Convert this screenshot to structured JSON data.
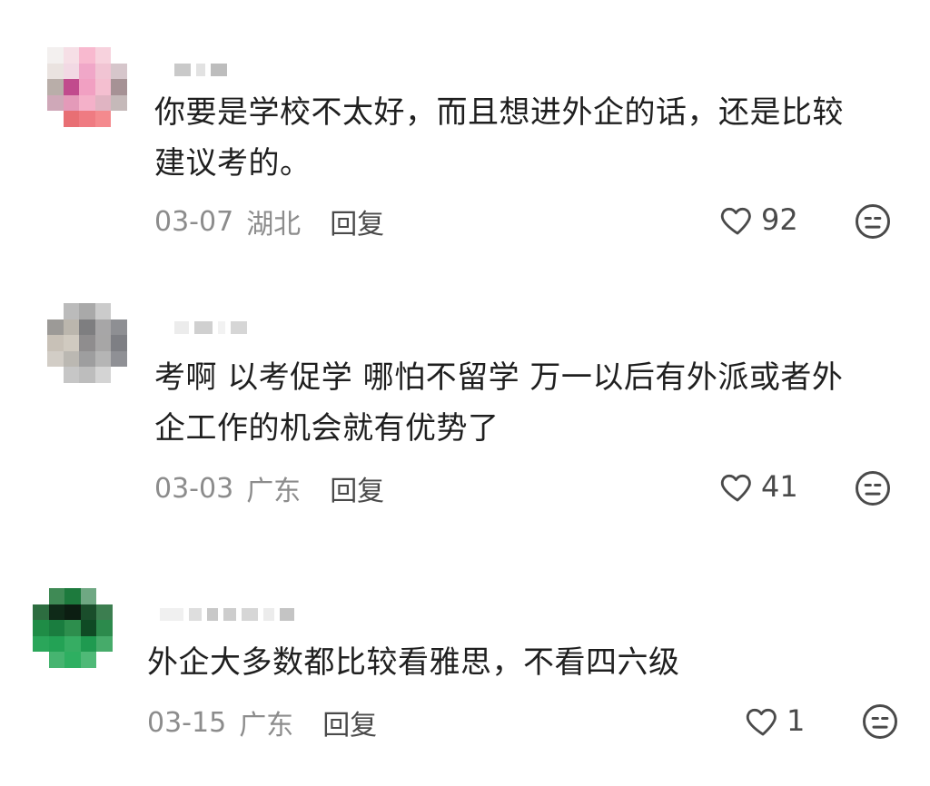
{
  "comments": [
    {
      "text_line1": "你要是学校不太好，而且想进外企的话，还是比较",
      "text_line2": "建议考的。",
      "date": "03-07",
      "region": "湖北",
      "reply_label": "回复",
      "likes": "92",
      "like_icon": "heart-icon",
      "dislike_icon": "neutral-face-icon"
    },
    {
      "text_line1": "考啊 以考促学 哪怕不留学 万一以后有外派或者外",
      "text_line2": "企工作的机会就有优势了",
      "date": "03-03",
      "region": "广东",
      "reply_label": "回复",
      "likes": "41",
      "like_icon": "heart-icon",
      "dislike_icon": "neutral-face-icon"
    },
    {
      "text_line1": "外企大多数都比较看雅思，不看四六级",
      "text_line2": "",
      "date": "03-15",
      "region": "广东",
      "reply_label": "回复",
      "likes": "1",
      "like_icon": "heart-icon",
      "dislike_icon": "neutral-face-icon"
    }
  ],
  "colors": {
    "text": "#1f1f1f",
    "meta": "#8c8c8c",
    "icon": "#4a4a4a"
  }
}
